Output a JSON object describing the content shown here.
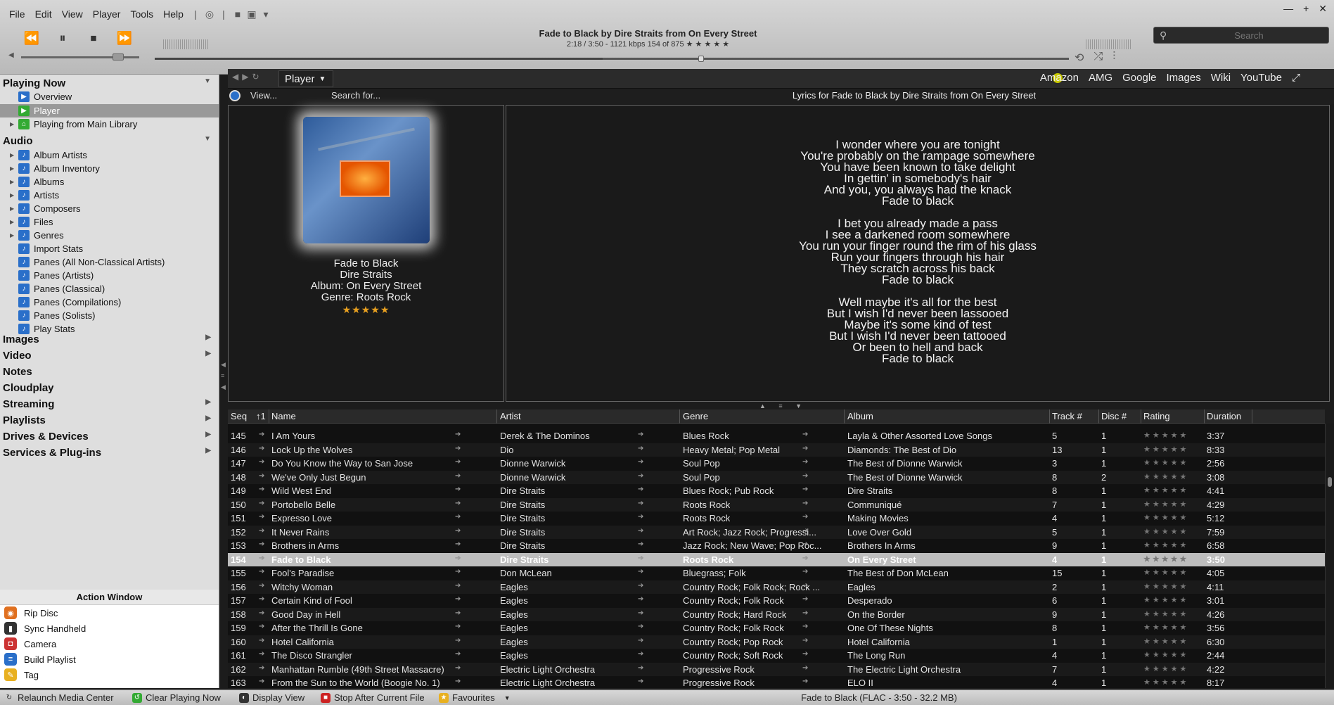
{
  "menu": [
    "File",
    "Edit",
    "View",
    "Player",
    "Tools",
    "Help"
  ],
  "now_playing": {
    "title": "Fade to Black by Dire Straits from On Every Street",
    "sub": "2:18 / 3:50 - 1121 kbps   154 of 875  ★ ★ ★ ★ ★"
  },
  "search": {
    "placeholder": "Search"
  },
  "sidebar": {
    "playing_now": "Playing Now",
    "overview": "Overview",
    "player": "Player",
    "playing_from": "Playing from Main Library",
    "audio": "Audio",
    "audio_items": [
      "Album Artists",
      "Album Inventory",
      "Albums",
      "Artists",
      "Composers",
      "Files",
      "Genres",
      "Import Stats",
      "Panes (All Non-Classical Artists)",
      "Panes (Artists)",
      "Panes (Classical)",
      "Panes (Compilations)",
      "Panes (Solists)",
      "Play Stats"
    ],
    "images": "Images",
    "video": "Video",
    "notes": "Notes",
    "cloudplay": "Cloudplay",
    "streaming": "Streaming",
    "playlists": "Playlists",
    "drives": "Drives & Devices",
    "services": "Services & Plug-ins"
  },
  "action_window": {
    "title": "Action Window",
    "items": [
      "Rip Disc",
      "Sync Handheld",
      "Camera",
      "Build Playlist",
      "Tag"
    ]
  },
  "player_tab": "Player",
  "links": [
    "Amazon",
    "AMG",
    "Google",
    "Images",
    "Wiki",
    "YouTube"
  ],
  "view_label": "View...",
  "search_for": "Search for...",
  "lyrics_title": "Lyrics for Fade to Black by Dire Straits from On Every Street",
  "track": {
    "name": "Fade to Black",
    "artist": "Dire Straits",
    "album": "Album: On Every Street",
    "genre": "Genre: Roots Rock",
    "stars": "★★★★★"
  },
  "lyrics": [
    "I wonder where you are tonight",
    "You're probably on the rampage somewhere",
    "You have been known to take delight",
    "In gettin' in somebody's hair",
    "And you, you always had the knack",
    "Fade to black",
    "",
    "I bet you already made a pass",
    "I see a darkened room somewhere",
    "You run your finger round the rim of his glass",
    "Run your fingers through his hair",
    "They scratch across his back",
    "Fade to black",
    "",
    "Well maybe it's all for the best",
    "But I wish I'd never been lassooed",
    "Maybe it's some kind of test",
    "But I wish I'd never been tattooed",
    "Or been to hell and back",
    "Fade to black"
  ],
  "columns": [
    "Seq",
    "↑1",
    "Name",
    "Artist",
    "Genre",
    "Album",
    "Track #",
    "Disc #",
    "Rating",
    "Duration"
  ],
  "rows": [
    [
      "145",
      "I Am Yours",
      "Derek & The Dominos",
      "Blues Rock",
      "Layla & Other Assorted Love Songs",
      "5",
      "1",
      "3:37"
    ],
    [
      "146",
      "Lock Up the Wolves",
      "Dio",
      "Heavy Metal; Pop Metal",
      "Diamonds: The Best of Dio",
      "13",
      "1",
      "8:33"
    ],
    [
      "147",
      "Do You Know the Way to San Jose",
      "Dionne Warwick",
      "Soul Pop",
      "The Best of Dionne Warwick",
      "3",
      "1",
      "2:56"
    ],
    [
      "148",
      "We've Only Just Begun",
      "Dionne Warwick",
      "Soul Pop",
      "The Best of Dionne Warwick",
      "8",
      "2",
      "3:08"
    ],
    [
      "149",
      "Wild West End",
      "Dire Straits",
      "Blues Rock; Pub Rock",
      "Dire Straits",
      "8",
      "1",
      "4:41"
    ],
    [
      "150",
      "Portobello Belle",
      "Dire Straits",
      "Roots Rock",
      "Communiqué",
      "7",
      "1",
      "4:29"
    ],
    [
      "151",
      "Expresso Love",
      "Dire Straits",
      "Roots Rock",
      "Making Movies",
      "4",
      "1",
      "5:12"
    ],
    [
      "152",
      "It Never Rains",
      "Dire Straits",
      "Art Rock; Jazz Rock; Progressi...",
      "Love Over Gold",
      "5",
      "1",
      "7:59"
    ],
    [
      "153",
      "Brothers in Arms",
      "Dire Straits",
      "Jazz Rock; New Wave; Pop Roc...",
      "Brothers In Arms",
      "9",
      "1",
      "6:58"
    ],
    [
      "154",
      "Fade to Black",
      "Dire Straits",
      "Roots Rock",
      "On Every Street",
      "4",
      "1",
      "3:50"
    ],
    [
      "155",
      "Fool's Paradise",
      "Don McLean",
      "Bluegrass; Folk",
      "The Best of Don McLean",
      "15",
      "1",
      "4:05"
    ],
    [
      "156",
      "Witchy Woman",
      "Eagles",
      "Country Rock; Folk Rock; Rock ...",
      "Eagles",
      "2",
      "1",
      "4:11"
    ],
    [
      "157",
      "Certain Kind of Fool",
      "Eagles",
      "Country Rock; Folk Rock",
      "Desperado",
      "6",
      "1",
      "3:01"
    ],
    [
      "158",
      "Good Day in Hell",
      "Eagles",
      "Country Rock; Hard Rock",
      "On the Border",
      "9",
      "1",
      "4:26"
    ],
    [
      "159",
      "After the Thrill Is Gone",
      "Eagles",
      "Country Rock; Folk Rock",
      "One Of These Nights",
      "8",
      "1",
      "3:56"
    ],
    [
      "160",
      "Hotel California",
      "Eagles",
      "Country Rock; Pop Rock",
      "Hotel California",
      "1",
      "1",
      "6:30"
    ],
    [
      "161",
      "The Disco Strangler",
      "Eagles",
      "Country Rock; Soft Rock",
      "The Long Run",
      "4",
      "1",
      "2:44"
    ],
    [
      "162",
      "Manhattan Rumble (49th Street Massacre)",
      "Electric Light Orchestra",
      "Progressive Rock",
      "The Electric Light Orchestra",
      "7",
      "1",
      "4:22"
    ],
    [
      "163",
      "From the Sun to the World (Boogie No. 1)",
      "Electric Light Orchestra",
      "Progressive Rock",
      "ELO II",
      "4",
      "1",
      "8:17"
    ]
  ],
  "rating_stars": "★★★★★",
  "selected_row": 9,
  "status": {
    "relaunch": "Relaunch Media Center",
    "clear": "Clear Playing Now",
    "display": "Display View",
    "stop_after": "Stop After Current File",
    "favourites": "Favourites",
    "info": "Fade to Black (FLAC - 3:50 - 32.2 MB)"
  }
}
